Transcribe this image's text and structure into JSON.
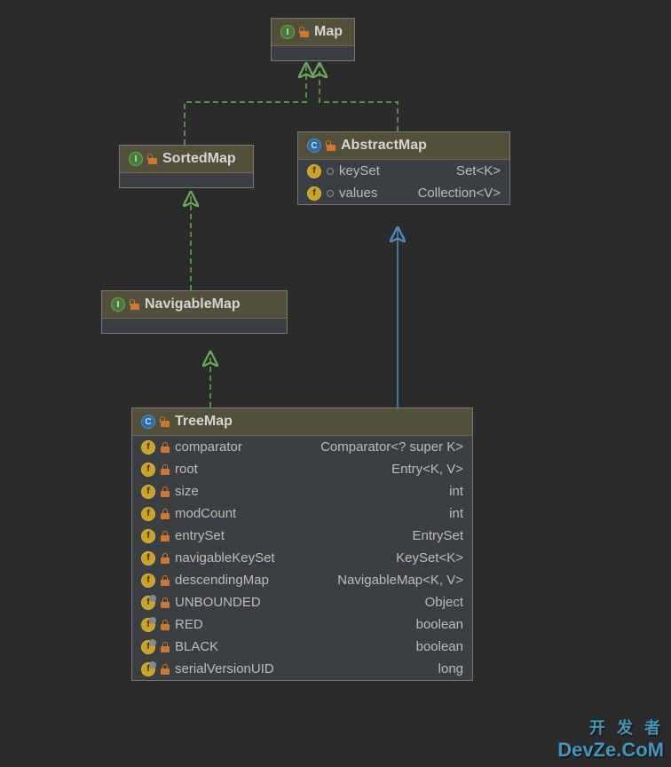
{
  "classes": {
    "map": {
      "name": "Map",
      "kind": "interface"
    },
    "sortedMap": {
      "name": "SortedMap",
      "kind": "interface"
    },
    "navigableMap": {
      "name": "NavigableMap",
      "kind": "interface"
    },
    "abstractMap": {
      "name": "AbstractMap",
      "kind": "abstract",
      "members": [
        {
          "name": "keySet",
          "type": "Set<K>",
          "icon": "field",
          "vis": "package"
        },
        {
          "name": "values",
          "type": "Collection<V>",
          "icon": "field",
          "vis": "package"
        }
      ]
    },
    "treeMap": {
      "name": "TreeMap",
      "kind": "class",
      "members": [
        {
          "name": "comparator",
          "type": "Comparator<? super K>",
          "icon": "field",
          "vis": "private"
        },
        {
          "name": "root",
          "type": "Entry<K, V>",
          "icon": "field",
          "vis": "private"
        },
        {
          "name": "size",
          "type": "int",
          "icon": "field",
          "vis": "private"
        },
        {
          "name": "modCount",
          "type": "int",
          "icon": "field",
          "vis": "private"
        },
        {
          "name": "entrySet",
          "type": "EntrySet",
          "icon": "field",
          "vis": "private"
        },
        {
          "name": "navigableKeySet",
          "type": "KeySet<K>",
          "icon": "field",
          "vis": "private"
        },
        {
          "name": "descendingMap",
          "type": "NavigableMap<K, V>",
          "icon": "field",
          "vis": "private"
        },
        {
          "name": "UNBOUNDED",
          "type": "Object",
          "icon": "field-static",
          "vis": "private"
        },
        {
          "name": "RED",
          "type": "boolean",
          "icon": "field-static",
          "vis": "private"
        },
        {
          "name": "BLACK",
          "type": "boolean",
          "icon": "field-static",
          "vis": "private"
        },
        {
          "name": "serialVersionUID",
          "type": "long",
          "icon": "field-static",
          "vis": "private"
        }
      ]
    }
  },
  "watermark": {
    "line1": "开 发 者",
    "line2": "DevZe.CoM"
  },
  "colors": {
    "interfaceArrow": "#6aaa5a",
    "classArrow": "#4d8cc2"
  }
}
